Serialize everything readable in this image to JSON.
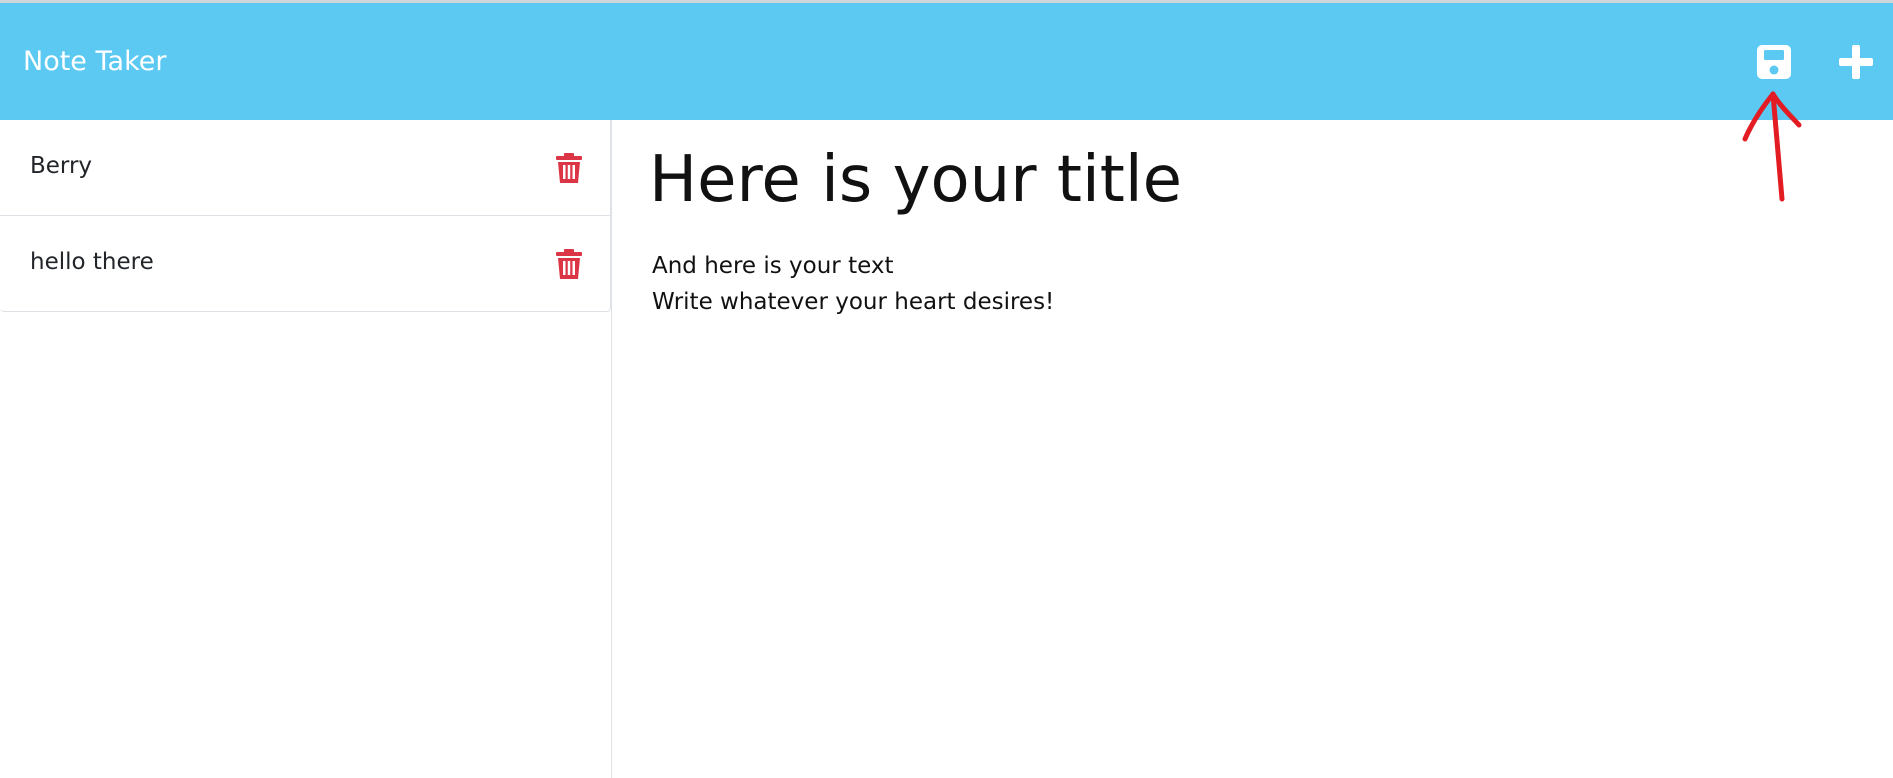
{
  "navbar": {
    "brand": "Note Taker",
    "actions": [
      {
        "name": "save",
        "icon": "floppy-disk-icon"
      },
      {
        "name": "new-note",
        "icon": "plus-icon"
      }
    ],
    "background": "#5bc9f2"
  },
  "sidebar": {
    "notes": [
      {
        "title": "Berry",
        "icon": "trash-icon"
      },
      {
        "title": "hello there",
        "icon": "trash-icon"
      }
    ],
    "delete_color": "#dc3545"
  },
  "editor": {
    "title": "Here is your title",
    "lines": [
      "And here is your text",
      "Write whatever your heart desires!"
    ]
  },
  "annotation": {
    "icon": "red-arrow-icon",
    "color": "#e31b23"
  }
}
